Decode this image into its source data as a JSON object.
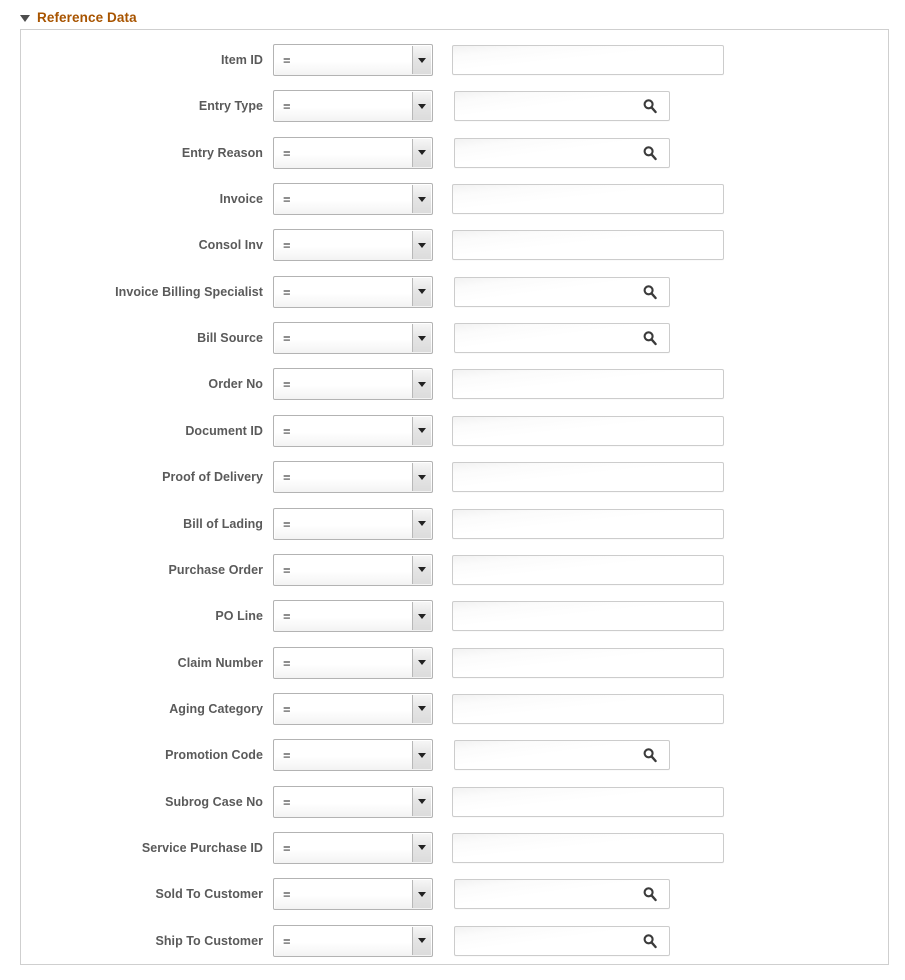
{
  "section": {
    "title": "Reference Data",
    "collapse_icon": "triangle-down-icon",
    "expanded": true,
    "title_color": "#a85400"
  },
  "operator_default": "=",
  "lookup_icon": "search-icon",
  "rows": [
    {
      "label": "Item ID",
      "operator": "=",
      "value": "",
      "lookup": false
    },
    {
      "label": "Entry Type",
      "operator": "=",
      "value": "",
      "lookup": true
    },
    {
      "label": "Entry Reason",
      "operator": "=",
      "value": "",
      "lookup": true
    },
    {
      "label": "Invoice",
      "operator": "=",
      "value": "",
      "lookup": false
    },
    {
      "label": "Consol Inv",
      "operator": "=",
      "value": "",
      "lookup": false
    },
    {
      "label": "Invoice Billing Specialist",
      "operator": "=",
      "value": "",
      "lookup": true
    },
    {
      "label": "Bill Source",
      "operator": "=",
      "value": "",
      "lookup": true
    },
    {
      "label": "Order No",
      "operator": "=",
      "value": "",
      "lookup": false
    },
    {
      "label": "Document ID",
      "operator": "=",
      "value": "",
      "lookup": false
    },
    {
      "label": "Proof of Delivery",
      "operator": "=",
      "value": "",
      "lookup": false
    },
    {
      "label": "Bill of Lading",
      "operator": "=",
      "value": "",
      "lookup": false
    },
    {
      "label": "Purchase Order",
      "operator": "=",
      "value": "",
      "lookup": false
    },
    {
      "label": "PO Line",
      "operator": "=",
      "value": "",
      "lookup": false
    },
    {
      "label": "Claim Number",
      "operator": "=",
      "value": "",
      "lookup": false
    },
    {
      "label": "Aging Category",
      "operator": "=",
      "value": "",
      "lookup": false
    },
    {
      "label": "Promotion Code",
      "operator": "=",
      "value": "",
      "lookup": true
    },
    {
      "label": "Subrog Case No",
      "operator": "=",
      "value": "",
      "lookup": false
    },
    {
      "label": "Service Purchase ID",
      "operator": "=",
      "value": "",
      "lookup": false
    },
    {
      "label": "Sold To Customer",
      "operator": "=",
      "value": "",
      "lookup": true
    },
    {
      "label": "Ship To Customer",
      "operator": "=",
      "value": "",
      "lookup": true
    }
  ]
}
